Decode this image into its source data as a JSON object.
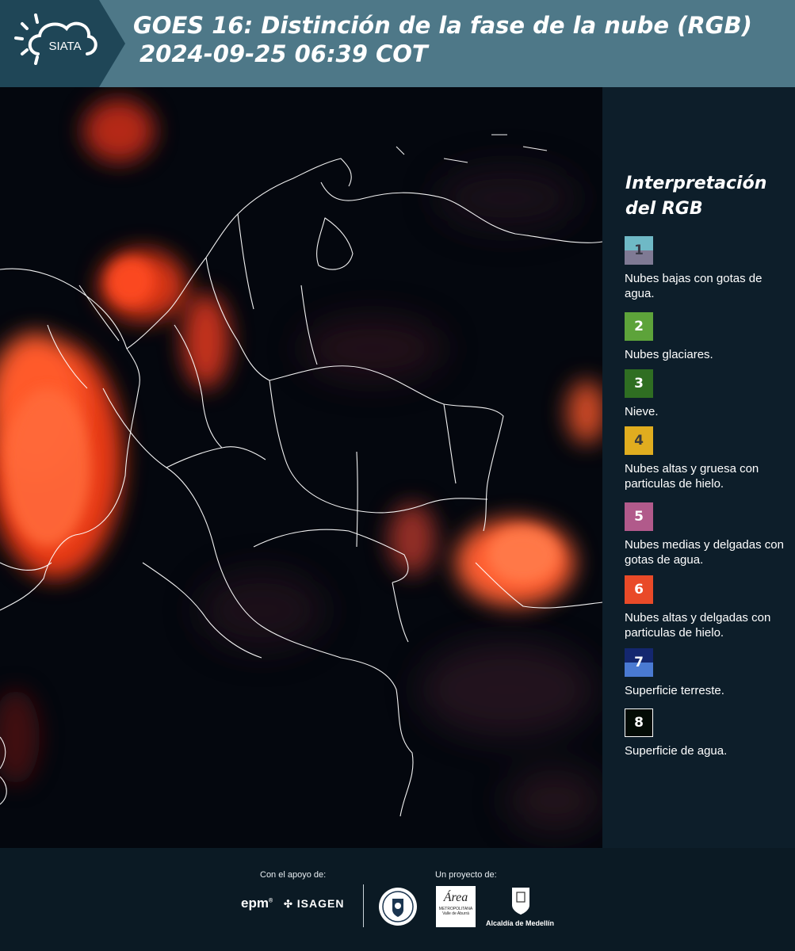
{
  "header": {
    "logo_text": "SIATA",
    "title_line1": "GOES 16: Distinción de la fase de la nube (RGB)",
    "title_line2": "2024-09-25 06:39 COT"
  },
  "legend": {
    "title": "Interpretación del RGB",
    "items": [
      {
        "number": "1",
        "text": "Nubes bajas con gotas de agua.",
        "color_top": "#6fb9c6",
        "color_bottom": "#7f7a94",
        "number_color": "#3a3a48"
      },
      {
        "number": "2",
        "text": "Nubes glaciares.",
        "color_top": "#5da33a",
        "color_bottom": "#5da33a",
        "number_color": "#ffffff"
      },
      {
        "number": "3",
        "text": "Nieve.",
        "color_top": "#2f6e22",
        "color_bottom": "#2f6e22",
        "number_color": "#ffffff"
      },
      {
        "number": "4",
        "text": "Nubes altas y gruesa con particulas de hielo.",
        "color_top": "#e0ad1f",
        "color_bottom": "#e0ad1f",
        "number_color": "#3a3a3a"
      },
      {
        "number": "5",
        "text": "Nubes medias y delgadas con gotas de agua.",
        "color_top": "#b15a8b",
        "color_bottom": "#b15a8b",
        "number_color": "#ffffff"
      },
      {
        "number": "6",
        "text": "Nubes altas y delgadas con particulas de hielo.",
        "color_top": "#e94a28",
        "color_bottom": "#e94a28",
        "number_color": "#ffffff"
      },
      {
        "number": "7",
        "text": "Superficie terreste.",
        "color_top": "#14276f",
        "color_bottom": "#4a7ad2",
        "number_color": "#ffffff"
      },
      {
        "number": "8",
        "text": "Superficie de agua.",
        "color_top": "#030b05",
        "color_bottom": "#030b05",
        "number_color": "#ffffff"
      }
    ]
  },
  "footer": {
    "support_label": "Con el apoyo de:",
    "project_label": "Un proyecto de:",
    "epm_text": "epm",
    "isagen_text": "ISAGEN",
    "area_text": "Área",
    "area_sub1": "METROPOLITANA",
    "area_sub2": "Valle de Aburrá",
    "alcaldia_text": "Alcaldía de Medellín"
  },
  "colors": {
    "header_bg": "#4e7888",
    "logo_tab_bg": "#1f4657",
    "panel_bg": "#0d1e2a",
    "map_bg": "#03060d",
    "cloud_red": "#ff3a1a"
  }
}
